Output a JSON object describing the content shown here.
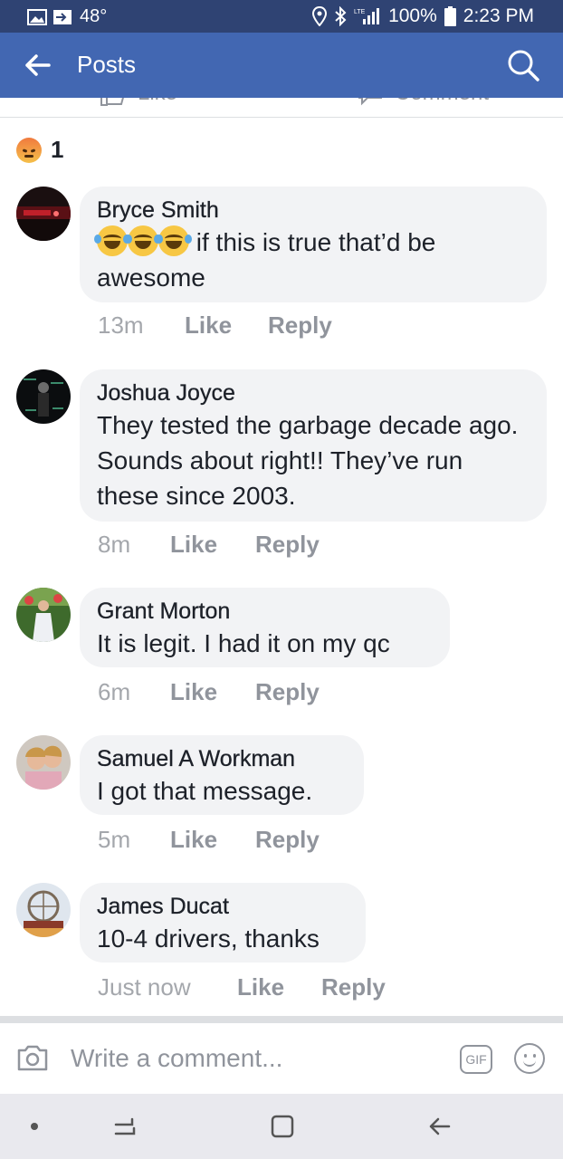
{
  "status_bar": {
    "temperature": "48°",
    "battery": "100%",
    "time": "2:23 PM",
    "icons": [
      "image-icon",
      "cast-icon",
      "location-icon",
      "bluetooth-icon",
      "lte-signal-icon",
      "battery-icon"
    ]
  },
  "header": {
    "title": "Posts",
    "back_icon": "back-arrow-icon",
    "search_icon": "search-icon",
    "background": "#4267b2"
  },
  "action_row": {
    "like_label": "Like",
    "comment_label": "Comment"
  },
  "reactions": {
    "type": "angry",
    "count": "1"
  },
  "comments": [
    {
      "author": "Bryce Smith",
      "emoji_prefix": [
        "laughing-tears-emoji",
        "laughing-tears-emoji",
        "laughing-tears-emoji"
      ],
      "text": "if this is true that’d be awesome",
      "time": "13m",
      "like": "Like",
      "reply": "Reply"
    },
    {
      "author": "Joshua Joyce",
      "text": "They tested the garbage decade ago. Sounds about right!! They’ve run these since 2003.",
      "time": "8m",
      "like": "Like",
      "reply": "Reply"
    },
    {
      "author": "Grant Morton",
      "text": "It is legit. I had it on my qc",
      "time": "6m",
      "like": "Like",
      "reply": "Reply"
    },
    {
      "author": "Samuel A Workman",
      "text": "I got that message.",
      "time": "5m",
      "like": "Like",
      "reply": "Reply"
    },
    {
      "author": "James Ducat",
      "text": "10-4 drivers, thanks",
      "time": "Just now",
      "like": "Like",
      "reply": "Reply"
    }
  ],
  "composer": {
    "placeholder": "Write a comment...",
    "gif_label": "GIF"
  },
  "colors": {
    "brand_blue": "#4267b2",
    "status_bar": "#2f4373",
    "bubble": "#f2f3f5",
    "meta_gray": "#90949c"
  }
}
